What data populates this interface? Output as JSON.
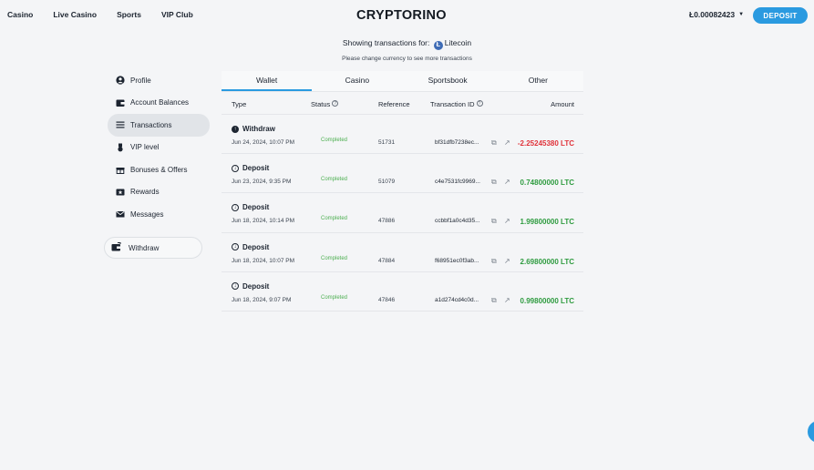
{
  "nav": {
    "items": [
      "Casino",
      "Live Casino",
      "Sports",
      "VIP Club"
    ]
  },
  "brand": {
    "logo": "CRYPTORINO"
  },
  "account": {
    "balance": "Ł0.00082423",
    "deposit_label": "DEPOSIT"
  },
  "currency_notice": {
    "prefix": "Showing transactions for:",
    "currency": "Litecoin",
    "hint": "Please change currency to see more transactions"
  },
  "sidebar": {
    "items": [
      {
        "label": "Profile",
        "icon": "profile-icon"
      },
      {
        "label": "Account Balances",
        "icon": "wallet-icon"
      },
      {
        "label": "Transactions",
        "icon": "list-icon",
        "active": true
      },
      {
        "label": "VIP level",
        "icon": "medal-icon"
      },
      {
        "label": "Bonuses & Offers",
        "icon": "gift-icon"
      },
      {
        "label": "Rewards",
        "icon": "star-ticket-icon"
      },
      {
        "label": "Messages",
        "icon": "mail-icon"
      }
    ],
    "withdraw_label": "Withdraw"
  },
  "tabs": [
    "Wallet",
    "Casino",
    "Sportsbook",
    "Other"
  ],
  "table": {
    "headers": {
      "type": "Type",
      "status": "Status",
      "reference": "Reference",
      "txid": "Transaction ID",
      "amount": "Amount"
    },
    "rows": [
      {
        "type": "Withdraw",
        "date": "Jun 24, 2024, 10:07 PM",
        "status": "Completed",
        "reference": "51731",
        "txid": "bf31dfb7238ec...",
        "amount": "-2.25245380 LTC",
        "sign": "neg"
      },
      {
        "type": "Deposit",
        "date": "Jun 23, 2024, 9:35 PM",
        "status": "Completed",
        "reference": "51079",
        "txid": "c4e7531fc9969...",
        "amount": "0.74800000 LTC",
        "sign": "pos"
      },
      {
        "type": "Deposit",
        "date": "Jun 18, 2024, 10:14 PM",
        "status": "Completed",
        "reference": "47886",
        "txid": "ccbbf1a0c4d35...",
        "amount": "1.99800000 LTC",
        "sign": "pos"
      },
      {
        "type": "Deposit",
        "date": "Jun 18, 2024, 10:07 PM",
        "status": "Completed",
        "reference": "47884",
        "txid": "f68951ec0f3ab...",
        "amount": "2.69800000 LTC",
        "sign": "pos"
      },
      {
        "type": "Deposit",
        "date": "Jun 18, 2024, 9:07 PM",
        "status": "Completed",
        "reference": "47846",
        "txid": "a1d274cd4c0d...",
        "amount": "0.99800000 LTC",
        "sign": "pos"
      }
    ]
  },
  "colors": {
    "accent": "#2a9ae0",
    "negative": "#e0323a",
    "positive": "#2e9b3f",
    "status_completed": "#4caf50"
  }
}
